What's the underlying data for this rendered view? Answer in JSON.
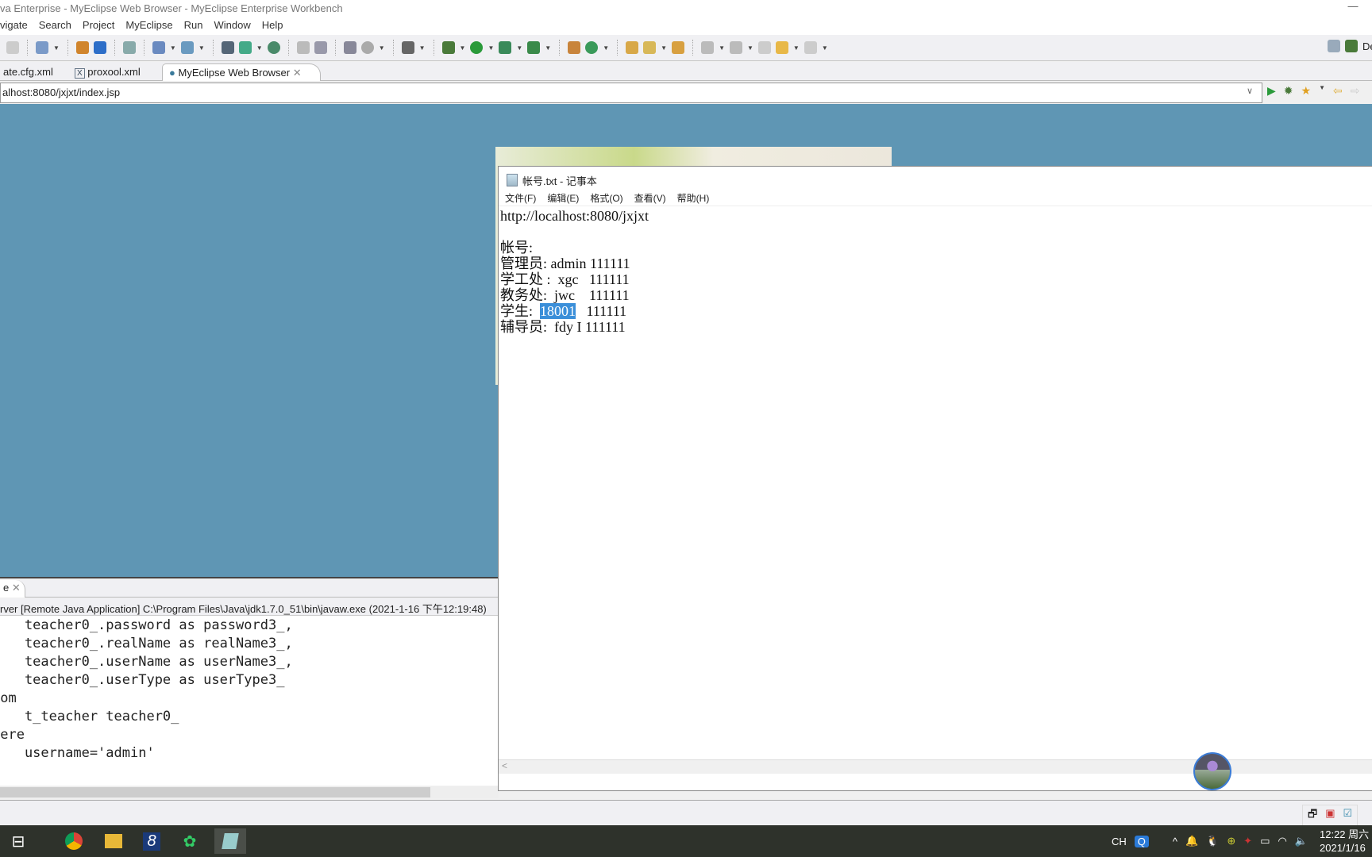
{
  "window": {
    "title": "va Enterprise - MyEclipse Web Browser - MyEclipse Enterprise Workbench"
  },
  "menu": [
    "vigate",
    "Search",
    "Project",
    "MyEclipse",
    "Run",
    "Window",
    "Help"
  ],
  "tabs": [
    {
      "label": "ate.cfg.xml"
    },
    {
      "label": "proxool.xml",
      "icon": "xml-file-icon"
    },
    {
      "label": "MyEclipse Web Browser",
      "icon": "globe-icon",
      "active": true
    }
  ],
  "perspective": {
    "label": "De"
  },
  "browser": {
    "url": "alhost:8080/jxjxt/index.jsp"
  },
  "console": {
    "tab_label": "e",
    "header": "rver [Remote Java Application] C:\\Program Files\\Java\\jdk1.7.0_51\\bin\\javaw.exe (2021-1-16 下午12:19:48)",
    "lines": [
      "    teacher0_.password as password3_,",
      "    teacher0_.realName as realName3_,",
      "    teacher0_.userName as userName3_,",
      "    teacher0_.userType as userType3_",
      "rom",
      "    t_teacher teacher0_",
      "here",
      "    username='admin'"
    ]
  },
  "notepad": {
    "title": "帐号.txt - 记事本",
    "menu": [
      "文件(F)",
      "编辑(E)",
      "格式(O)",
      "查看(V)",
      "帮助(H)"
    ],
    "lines": [
      "http://localhost:8080/jxjxt",
      "",
      "帐号:",
      "管理员: admin 111111",
      "学工处 :  xgc   111111",
      "教务处:  jwc    111111"
    ],
    "student_prefix": "学生:  ",
    "student_selected": "18001",
    "student_suffix": "   111111",
    "last_line": "辅导员:  fdy I 111111"
  },
  "tray": {
    "lang": "CH",
    "time": "12:22 周六",
    "date": "2021/1/16"
  },
  "colors": {
    "browser_bg": "#5f96b4",
    "selection": "#3b8fd9",
    "taskbar": "#2e322b"
  }
}
